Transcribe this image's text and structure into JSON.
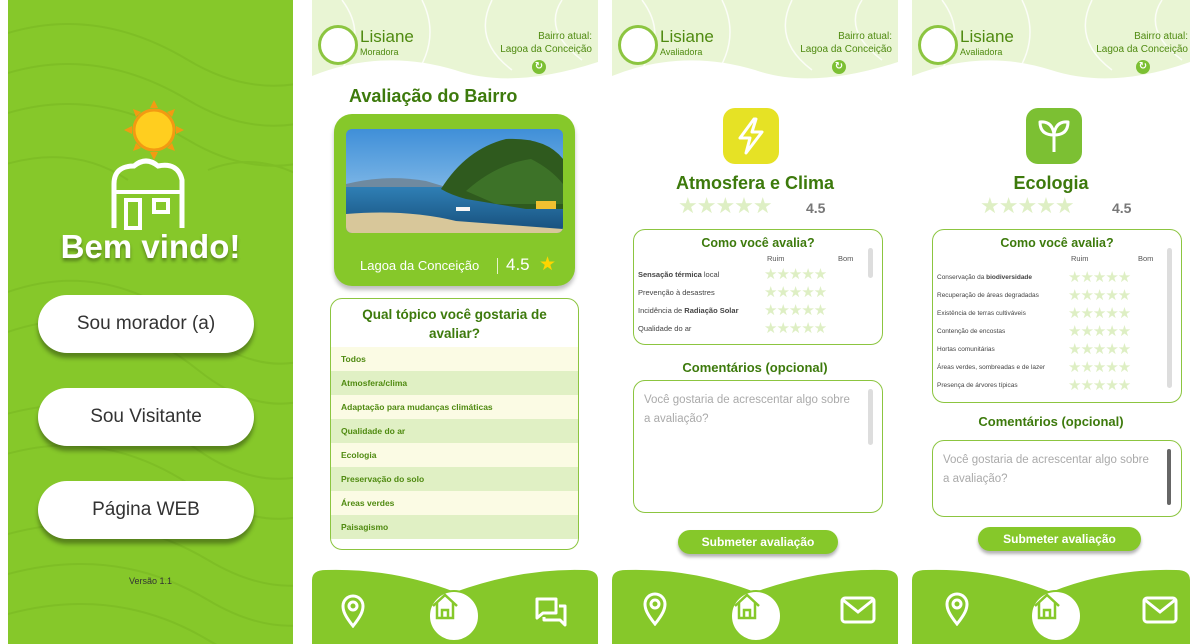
{
  "welcome": {
    "title": "Bem vindo!",
    "buttons": [
      "Sou morador (a)",
      "Sou Visitante",
      "Página WEB"
    ],
    "version": "Versão 1.1"
  },
  "screen_bairro": {
    "user": {
      "name": "Lisiane",
      "role": "Moradora"
    },
    "bairro_label": "Bairro atual:",
    "bairro_value": "Lagoa da Conceição",
    "title": "Avaliação do Bairro",
    "card": {
      "name": "Lagoa da Conceição",
      "rating": "4.5",
      "star": "★"
    },
    "question": "Qual tópico você gostaria de avaliar?",
    "topics": [
      "Todos",
      "Atmosfera/clima",
      "Adaptação para mudanças climáticas",
      "Qualidade do ar",
      "Ecologia",
      "Preservação do solo",
      "Áreas verdes",
      "Paisagismo"
    ]
  },
  "screen_atmosfera": {
    "user": {
      "name": "Lisiane",
      "role": "Avaliadora"
    },
    "bairro_label": "Bairro atual:",
    "bairro_value": "Lagoa da Conceição",
    "category": "Atmosfera e Clima",
    "icon": "lightning-icon",
    "icon_color": "#e6e225",
    "rating": "4.5",
    "stars_display": "★★★★★",
    "question": "Como você avalia?",
    "scale_low": "Ruim",
    "scale_high": "Bom",
    "criteria": [
      {
        "bold_pre": "Sensação térmica",
        "rest": " local",
        "bold_post": ""
      },
      {
        "bold_pre": "",
        "rest": "Prevenção à desastres",
        "bold_post": ""
      },
      {
        "bold_pre": "",
        "rest": "Incidência de ",
        "bold_post": "Radiação Solar"
      },
      {
        "bold_pre": "",
        "rest": "Qualidade do ar",
        "bold_post": ""
      }
    ],
    "comments_title": "Comentários (opcional)",
    "comments_placeholder": "Você gostaria de acrescentar algo sobre a avaliação?",
    "submit": "Submeter avaliação"
  },
  "screen_ecologia": {
    "user": {
      "name": "Lisiane",
      "role": "Avaliadora"
    },
    "bairro_label": "Bairro atual:",
    "bairro_value": "Lagoa da Conceição",
    "category": "Ecologia",
    "icon": "sprout-icon",
    "icon_color": "#7cc033",
    "rating": "4.5",
    "stars_display": "★★★★★",
    "question": "Como você avalia?",
    "scale_low": "Ruim",
    "scale_high": "Bom",
    "criteria": [
      {
        "bold_pre": "",
        "rest": "Conservação da ",
        "bold_post": "biodiversidade"
      },
      {
        "bold_pre": "",
        "rest": "Recuperação de áreas degradadas",
        "bold_post": ""
      },
      {
        "bold_pre": "",
        "rest": "Existência de terras cultiváveis",
        "bold_post": ""
      },
      {
        "bold_pre": "",
        "rest": "Contenção de encostas",
        "bold_post": ""
      },
      {
        "bold_pre": "",
        "rest": "Hortas comunitárias",
        "bold_post": ""
      },
      {
        "bold_pre": "",
        "rest": "Áreas verdes, sombreadas e de lazer",
        "bold_post": ""
      },
      {
        "bold_pre": "",
        "rest": "Presença de árvores típicas",
        "bold_post": ""
      }
    ],
    "comments_title": "Comentários (opcional)",
    "comments_placeholder": "Você gostaria de acrescentar algo sobre a avaliação?",
    "submit": "Submeter avaliação"
  },
  "colors": {
    "brand_green": "#86c82a",
    "dark_green": "#3d7a0c",
    "header_green": "#e9f5d4"
  }
}
